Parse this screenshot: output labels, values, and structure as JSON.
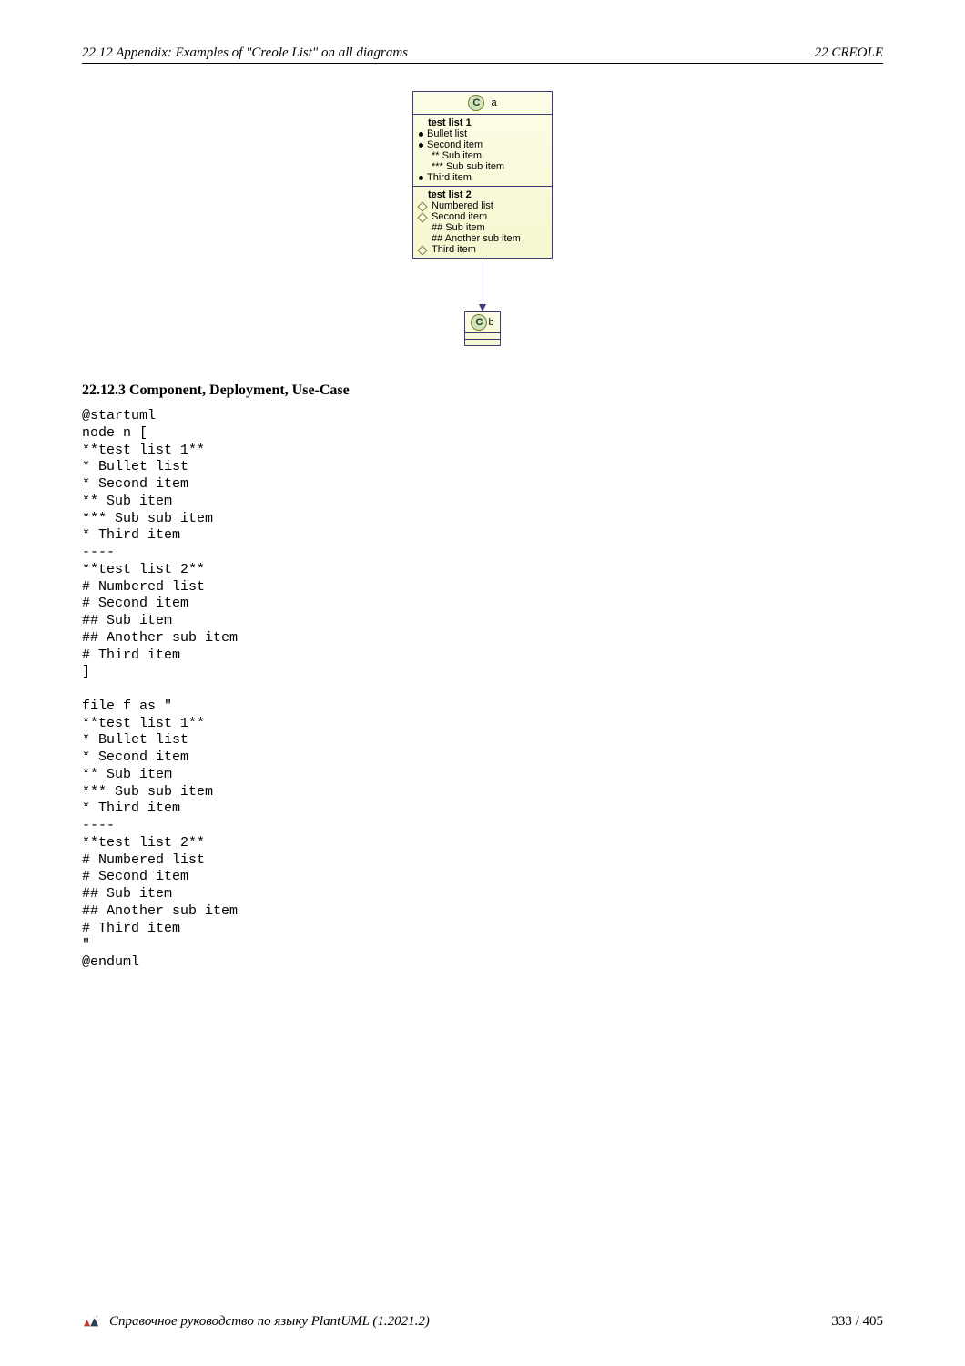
{
  "header": {
    "left": "22.12   Appendix: Examples of \"Creole List\" on all diagrams",
    "right": "22   CREOLE"
  },
  "diagram": {
    "classA": {
      "letter": "C",
      "name": "a",
      "list1_title": "test list 1",
      "l1_i1": "Bullet list",
      "l1_i2": "Second item",
      "l1_i2s": "** Sub item",
      "l1_i2ss": "*** Sub sub item",
      "l1_i3": "Third item",
      "list2_title": "test list 2",
      "l2_i1": "Numbered list",
      "l2_i2": "Second item",
      "l2_i2s": "## Sub item",
      "l2_i2ss": "## Another sub item",
      "l2_i3": "Third item"
    },
    "classB": {
      "letter": "C",
      "name": "b"
    }
  },
  "subsection": "22.12.3   Component, Deployment, Use-Case",
  "code": "@startuml\nnode n [\n**test list 1**\n* Bullet list\n* Second item\n** Sub item\n*** Sub sub item\n* Third item\n----\n**test list 2**\n# Numbered list\n# Second item\n## Sub item\n## Another sub item\n# Third item\n]\n\nfile f as \"\n**test list 1**\n* Bullet list\n* Second item\n** Sub item\n*** Sub sub item\n* Third item\n----\n**test list 2**\n# Numbered list\n# Second item\n## Sub item\n## Another sub item\n# Third item\n\"\n@enduml",
  "footer": {
    "text": "Справочное руководство по языку PlantUML (1.2021.2)",
    "page": "333 / 405"
  }
}
